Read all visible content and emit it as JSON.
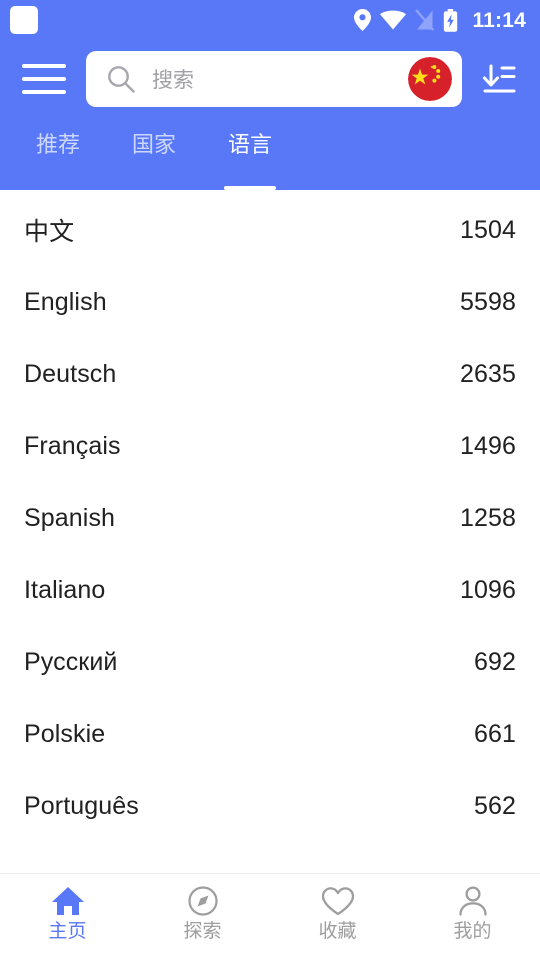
{
  "statusbar": {
    "notification_icon": "white-square-icon",
    "location_icon": "location-pin-icon",
    "wifi_icon": "wifi-icon",
    "signal_icon": "signal-no-service-icon",
    "battery_icon": "battery-charging-icon",
    "time": "11:14"
  },
  "appbar": {
    "menu_icon": "hamburger-menu-icon",
    "search": {
      "icon": "search-icon",
      "value": "",
      "placeholder": "搜索"
    },
    "flag_badge": "china-flag-icon",
    "sort_icon": "sort-descending-icon"
  },
  "tabs": {
    "active_index": 2,
    "items": [
      {
        "label": "推荐"
      },
      {
        "label": "国家"
      },
      {
        "label": "语言"
      }
    ]
  },
  "list": {
    "rows": [
      {
        "name": "中文",
        "count": "1504"
      },
      {
        "name": "English",
        "count": "5598"
      },
      {
        "name": "Deutsch",
        "count": "2635"
      },
      {
        "name": "Français",
        "count": "1496"
      },
      {
        "name": "Spanish",
        "count": "1258"
      },
      {
        "name": "Italiano",
        "count": "1096"
      },
      {
        "name": "Русский",
        "count": "692"
      },
      {
        "name": "Polskie",
        "count": "661"
      },
      {
        "name": "Português",
        "count": "562"
      }
    ]
  },
  "bottomnav": {
    "active_index": 0,
    "items": [
      {
        "label": "主页",
        "icon": "home-icon"
      },
      {
        "label": "探索",
        "icon": "compass-icon"
      },
      {
        "label": "收藏",
        "icon": "heart-icon"
      },
      {
        "label": "我的",
        "icon": "person-icon"
      }
    ]
  },
  "colors": {
    "accent": "#5878f8",
    "text_primary": "#212121",
    "text_muted": "#9e9e9e",
    "surface": "#ffffff"
  }
}
